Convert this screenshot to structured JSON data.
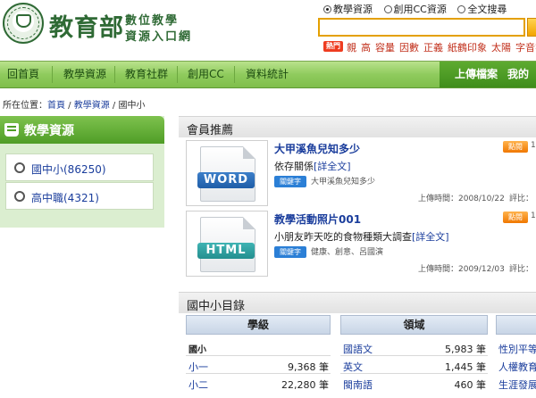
{
  "header": {
    "logo_main": "教育部",
    "logo_sub_line1": "數位教學",
    "logo_sub_line2": "資源入口網",
    "search_scopes": [
      {
        "label": "教學資源",
        "selected": true
      },
      {
        "label": "創用CC資源",
        "selected": false
      },
      {
        "label": "全文搜尋",
        "selected": false
      }
    ],
    "search_value": "",
    "hot_badge": "熱門",
    "hot_keywords": [
      "親",
      "高",
      "容量",
      "因數",
      "正義",
      "紙鶴印象",
      "太陽",
      "字音字形"
    ]
  },
  "nav": {
    "items": [
      "回首頁",
      "教學資源",
      "教育社群",
      "創用CC",
      "資料統計"
    ],
    "right_items": [
      "上傳檔案",
      "我的收"
    ]
  },
  "breadcrumb": {
    "prefix": "所在位置：",
    "home": "首頁",
    "sep1": " / ",
    "resources": "教學資源",
    "sep2": " / ",
    "current": "國中小"
  },
  "sidebar": {
    "title": "教學資源",
    "items": [
      {
        "label": "國中小(86250)"
      },
      {
        "label": "高中職(4321)"
      }
    ]
  },
  "member": {
    "title": "會員推薦",
    "cards": [
      {
        "file_type": "WORD",
        "title": "大甲溪魚兒知多少",
        "desc": "依存關係",
        "more": "[詳全文]",
        "kw_label": "關鍵字",
        "keywords": "大甲溪魚兒知多少",
        "date": "上傳時間：2008/10/22",
        "comments": "評比：",
        "click_badge": "點閱",
        "click_count": "1"
      },
      {
        "file_type": "HTML",
        "title": "教學活動照片001",
        "desc": "小朋友昨天吃的食物種類大調查",
        "more": "[詳全文]",
        "kw_label": "關鍵字",
        "keywords": "健康、創意、呂國演",
        "date": "上傳時間：2009/12/03",
        "comments": "評比：",
        "click_badge": "點閱",
        "click_count": "1"
      }
    ]
  },
  "catalog": {
    "title": "國中小目錄",
    "col_grade": "學級",
    "col_domain": "領域",
    "grade_group": "國小",
    "grades": [
      {
        "name": "小一",
        "count": "9,368 筆"
      },
      {
        "name": "小二",
        "count": "22,280 筆"
      }
    ],
    "domains": [
      {
        "name": "國語文",
        "count": "5,983 筆"
      },
      {
        "name": "英文",
        "count": "1,445 筆"
      },
      {
        "name": "閩南語",
        "count": "460 筆"
      }
    ],
    "topics": [
      "性別平等",
      "人權教育",
      "生涯發展"
    ]
  }
}
